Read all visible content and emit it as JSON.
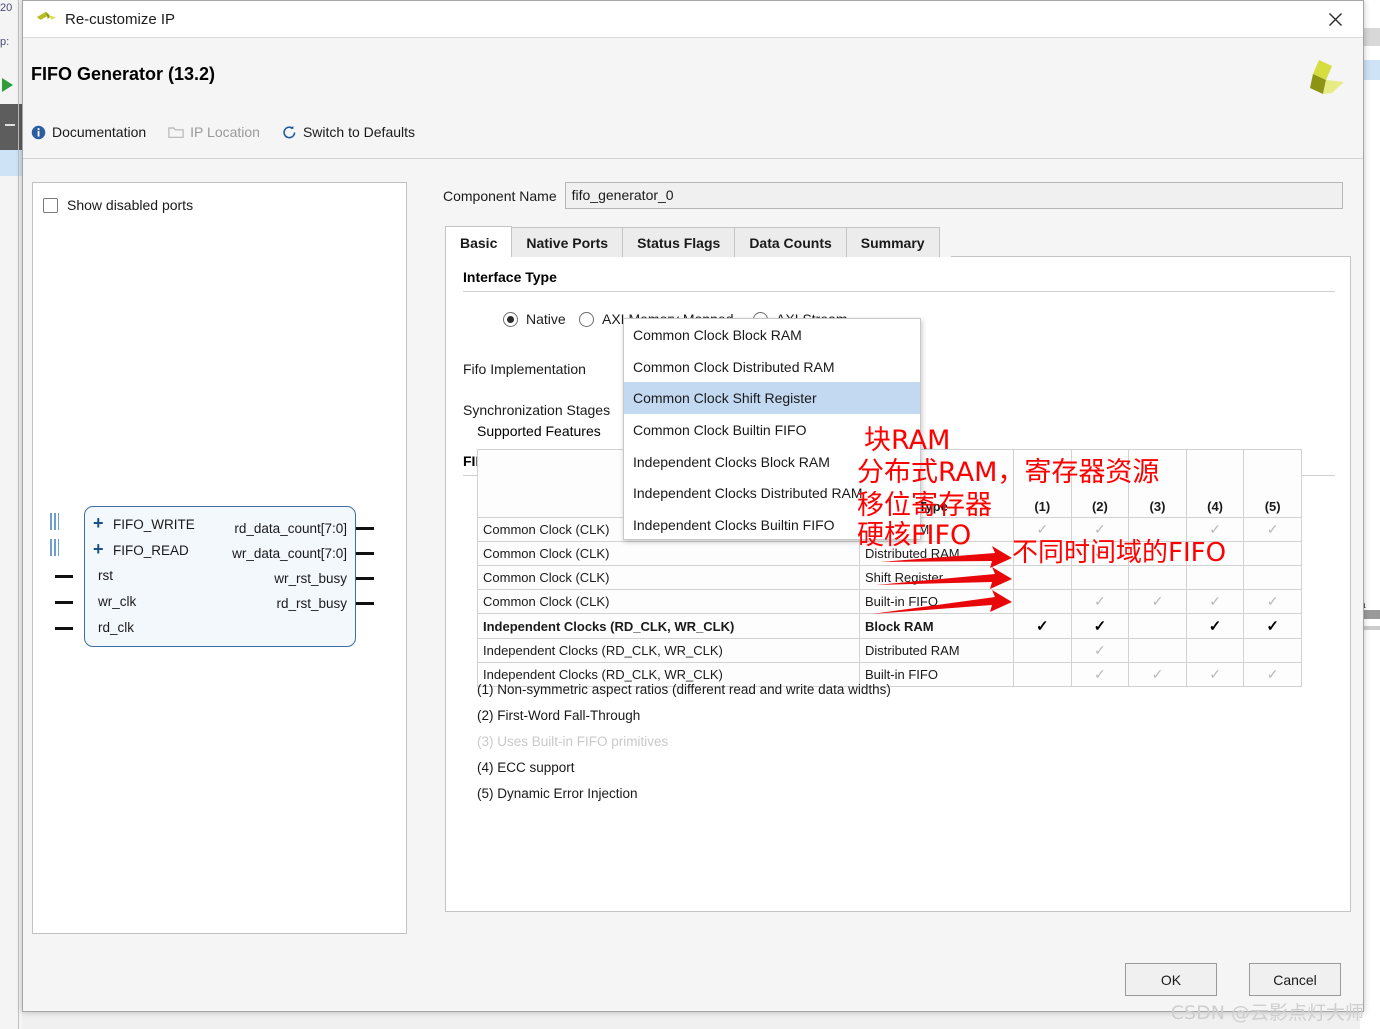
{
  "background": {
    "left_fragments": [
      "20",
      "p:"
    ],
    "right_fragments": [
      "m",
      "a",
      "n"
    ]
  },
  "titlebar": {
    "title": "Re-customize IP",
    "close_label": "✕"
  },
  "header": {
    "ip_title": "FIFO Generator (13.2)",
    "toolbar": [
      {
        "id": "documentation",
        "label": "Documentation",
        "icon": "info-icon",
        "disabled": false
      },
      {
        "id": "ip-location",
        "label": "IP Location",
        "icon": "folder-icon",
        "disabled": true
      },
      {
        "id": "switch-defaults",
        "label": "Switch to Defaults",
        "icon": "refresh-icon",
        "disabled": false
      }
    ]
  },
  "left_panel": {
    "show_disabled_ports_label": "Show disabled ports",
    "show_disabled_ports_checked": false,
    "symbol": {
      "bus_ports": [
        "FIFO_WRITE",
        "FIFO_READ"
      ],
      "input_ports": [
        "rst",
        "wr_clk",
        "rd_clk"
      ],
      "output_ports": [
        "rd_data_count[7:0]",
        "wr_data_count[7:0]",
        "wr_rst_busy",
        "rd_rst_busy"
      ]
    }
  },
  "component": {
    "name_label": "Component Name",
    "name_value": "fifo_generator_0"
  },
  "tabs": [
    {
      "label": "Basic",
      "active": true
    },
    {
      "label": "Native Ports",
      "active": false
    },
    {
      "label": "Status Flags",
      "active": false
    },
    {
      "label": "Data Counts",
      "active": false
    },
    {
      "label": "Summary",
      "active": false
    }
  ],
  "basic": {
    "interface_type_title": "Interface Type",
    "interface_options": [
      {
        "label": "Native",
        "selected": true
      },
      {
        "label": "AXI Memory Mapped",
        "selected": false
      },
      {
        "label": "AXI Stream",
        "selected": false
      }
    ],
    "fifo_impl_label": "Fifo Implementation",
    "fifo_impl_value": "Independent Clocks Block RAM",
    "sync_stages_label": "Synchronization Stages",
    "fifo_impl_options_title": "FIFO Implementation Options",
    "supported_features_label": "Supported Features",
    "dropdown_options": [
      {
        "label": "Common Clock Block RAM",
        "highlighted": false
      },
      {
        "label": "Common Clock Distributed RAM",
        "highlighted": false
      },
      {
        "label": "Common Clock Shift Register",
        "highlighted": true
      },
      {
        "label": "Common Clock Builtin FIFO",
        "highlighted": false
      },
      {
        "label": "Independent Clocks Block RAM",
        "highlighted": false
      },
      {
        "label": "Independent Clocks Distributed RAM",
        "highlighted": false
      },
      {
        "label": "Independent Clocks Builtin FIFO",
        "highlighted": false
      }
    ]
  },
  "support_table": {
    "headers": [
      "",
      "Memory Type",
      "(1)",
      "(2)",
      "(3)",
      "(4)",
      "(5)"
    ],
    "rows": [
      {
        "clock": "Common Clock (CLK)",
        "memory": "Block RAM",
        "marks": [
          true,
          true,
          false,
          true,
          true
        ],
        "bold": false
      },
      {
        "clock": "Common Clock (CLK)",
        "memory": "Distributed RAM",
        "marks": [
          false,
          true,
          false,
          false,
          false
        ],
        "bold": false
      },
      {
        "clock": "Common Clock (CLK)",
        "memory": "Shift Register",
        "marks": [
          false,
          false,
          false,
          false,
          false
        ],
        "bold": false
      },
      {
        "clock": "Common Clock (CLK)",
        "memory": "Built-in FIFO",
        "marks": [
          false,
          true,
          true,
          true,
          true
        ],
        "bold": false
      },
      {
        "clock": "Independent Clocks (RD_CLK, WR_CLK)",
        "memory": "Block RAM",
        "marks": [
          true,
          true,
          false,
          true,
          true
        ],
        "bold": true
      },
      {
        "clock": "Independent Clocks (RD_CLK, WR_CLK)",
        "memory": "Distributed RAM",
        "marks": [
          false,
          true,
          false,
          false,
          false
        ],
        "bold": false
      },
      {
        "clock": "Independent Clocks (RD_CLK, WR_CLK)",
        "memory": "Built-in FIFO",
        "marks": [
          false,
          true,
          true,
          true,
          true
        ],
        "bold": false
      }
    ],
    "check_glyph": "✓"
  },
  "footnotes": [
    {
      "text": "(1) Non-symmetric aspect ratios (different read and write data widths)",
      "dim": false
    },
    {
      "text": "(2) First-Word Fall-Through",
      "dim": false
    },
    {
      "text": "(3) Uses Built-in FIFO primitives",
      "dim": true
    },
    {
      "text": "(4) ECC support",
      "dim": false
    },
    {
      "text": "(5) Dynamic Error Injection",
      "dim": false
    }
  ],
  "buttons": {
    "ok": "OK",
    "cancel": "Cancel"
  },
  "annotations": {
    "color": "#ff0000",
    "notes": [
      {
        "id": "note-block-ram",
        "text": "块RAM"
      },
      {
        "id": "note-dist-ram",
        "text": "分布式RAM，寄存器资源"
      },
      {
        "id": "note-shift-reg",
        "text": "移位寄存器"
      },
      {
        "id": "note-hard-fifo",
        "text": "硬核FIFO"
      },
      {
        "id": "note-diff-clock",
        "text": "不同时间域的FIFO"
      }
    ]
  },
  "watermark": "CSDN @云影点灯大师"
}
